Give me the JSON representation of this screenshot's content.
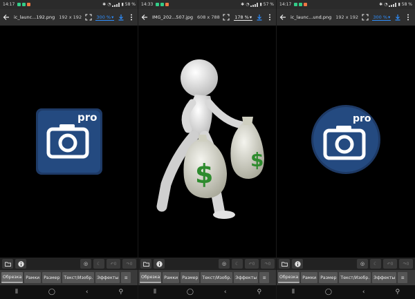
{
  "colors": {
    "accent": "#2f8fff",
    "toolbar": "#2f2f2f",
    "tab_bg": "#555555",
    "app_icon_blue": "#1e3a66"
  },
  "panels": [
    {
      "status": {
        "time": "14:17",
        "battery": "58 %"
      },
      "file_name": "ic_launc...192.png",
      "dimensions": "192 x 192",
      "zoom": "300 %",
      "tabs": [
        "Обрезка",
        "Рамки",
        "Размер",
        "Текст/Изобр.",
        "Эффекты"
      ],
      "undo_count": "0",
      "redo_count": "0",
      "image": "app-icon-rounded-square",
      "image_text": "pro"
    },
    {
      "status": {
        "time": "14:33",
        "battery": "57 %"
      },
      "file_name": "IMG_202...507.jpg",
      "dimensions": "608 x 788",
      "zoom": "178 %",
      "tabs": [
        "Обрезка",
        "Рамки",
        "Размер",
        "Текст/Изобр.",
        "Эффекты"
      ],
      "undo_count": "0",
      "redo_count": "0",
      "image": "3d-man-running-with-money-bags",
      "image_text": "$"
    },
    {
      "status": {
        "time": "14:17",
        "battery": "58 %"
      },
      "file_name": "ic_launc...und.png",
      "dimensions": "192 x 192",
      "zoom": "300 %",
      "tabs": [
        "Обрезка",
        "Рамки",
        "Размер",
        "Текст/Изобр.",
        "Эффекты"
      ],
      "undo_count": "0",
      "redo_count": "0",
      "image": "app-icon-round",
      "image_text": "pro"
    }
  ],
  "icons": [
    "back-arrow-icon",
    "fullscreen-icon",
    "download-icon",
    "more-vert-icon",
    "folder-icon",
    "info-icon",
    "compare-icon",
    "moon-icon",
    "undo-icon",
    "redo-icon",
    "menu-icon",
    "nav-recents-icon",
    "nav-home-icon",
    "nav-back-icon",
    "nav-accessibility-icon"
  ]
}
